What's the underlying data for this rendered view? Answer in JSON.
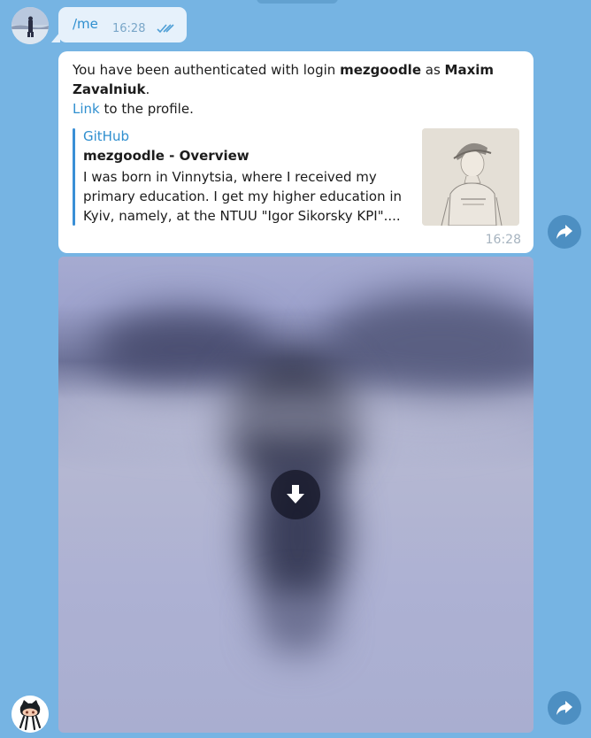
{
  "outgoing": {
    "text": "/me",
    "time": "16:28",
    "status_icon": "double-check-icon"
  },
  "message": {
    "prefix": "You have been authenticated with login ",
    "login": "mezgoodle",
    "as_word": " as ",
    "name": "Maxim Zavalniuk",
    "period": ".",
    "link_label": "Link",
    "link_suffix": " to the profile.",
    "time": "16:28",
    "preview": {
      "site": "GitHub",
      "title": "mezgoodle - Overview",
      "description": "I was born in Vinnytsia, where I received my primary education. I get my higher education in Kyiv, namely, at the NTUU \"Igor Sikorsky KPI\"...."
    }
  },
  "photo": {
    "download_icon": "download-arrow-icon"
  },
  "icons": {
    "share": "share-arrow-icon",
    "bot_avatar": "github-octocat-icon"
  },
  "colors": {
    "background": "#76b4e3",
    "accent": "#2f8fcf",
    "share_button": "#4d8fc2"
  }
}
